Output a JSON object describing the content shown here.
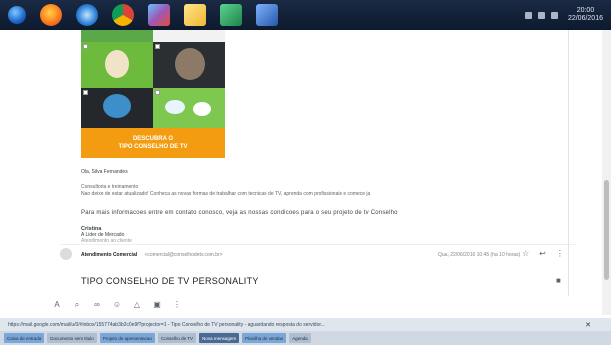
{
  "taskbar": {
    "apps": [
      "start",
      "firefox-icon",
      "ie-icon",
      "chrome-icon",
      "photo-icon",
      "paint-icon",
      "spreadsheet-icon",
      "document-icon"
    ],
    "tray_icons": [
      "wifi-icon",
      "volume-icon",
      "flag-icon"
    ],
    "clock_time": "20:00",
    "clock_date": "22/06/2016"
  },
  "email": {
    "banner_line1": "DESCUBRA O",
    "banner_line2": "TIPO CONSELHO DE TV",
    "greeting": "Ola, Silva Fernandes",
    "small_heading": "Consultoria e treinamento",
    "long_line": "Nao deixe de estar atualizado! Conheca as novas formas de trabalhar com tecnicas de TV, aprenda com profissionais e comece ja",
    "mid_line": "Para mais informacoes entre em contato conosco, veja as nossas condicoes para o seu projeto de tv Conselho",
    "sender_name": "Cristina",
    "sender_org": "A Lider de Mercado",
    "sender_extra": "Atendimento ao cliente",
    "row_sender": "Atendimento Comercial",
    "row_address": "<comercial@conselhodetv.com.br>",
    "row_date": "Qua, 22/06/2016 10:45 (ha 10 horas)",
    "subject": "TIPO CONSELHO DE TV PERSONALITY"
  },
  "status_bar": {
    "url": "https://mail.google.com/mail/u/0/#inbox/155774ab3b2c0e9f?projector=1 - Tipo Conselho de TV personality - aguardando resposta do servidor...",
    "close": "✕"
  },
  "bottom_tabs": [
    {
      "label": "Caixa de entrada",
      "style": "blue"
    },
    {
      "label": "Documento sem titulo",
      "style": ""
    },
    {
      "label": "Projeto de apresentacao",
      "style": "blue"
    },
    {
      "label": "Conselho de TV",
      "style": ""
    },
    {
      "label": "Nova mensagem",
      "style": "dark"
    },
    {
      "label": "Planilha de vendas",
      "style": "blue"
    },
    {
      "label": "Agenda",
      "style": ""
    }
  ],
  "colors": {
    "taskbar": "#0d1a2e",
    "banner": "#f39c12",
    "tile_green": "#6cbb3c",
    "tile_dark": "#2b2f33"
  }
}
